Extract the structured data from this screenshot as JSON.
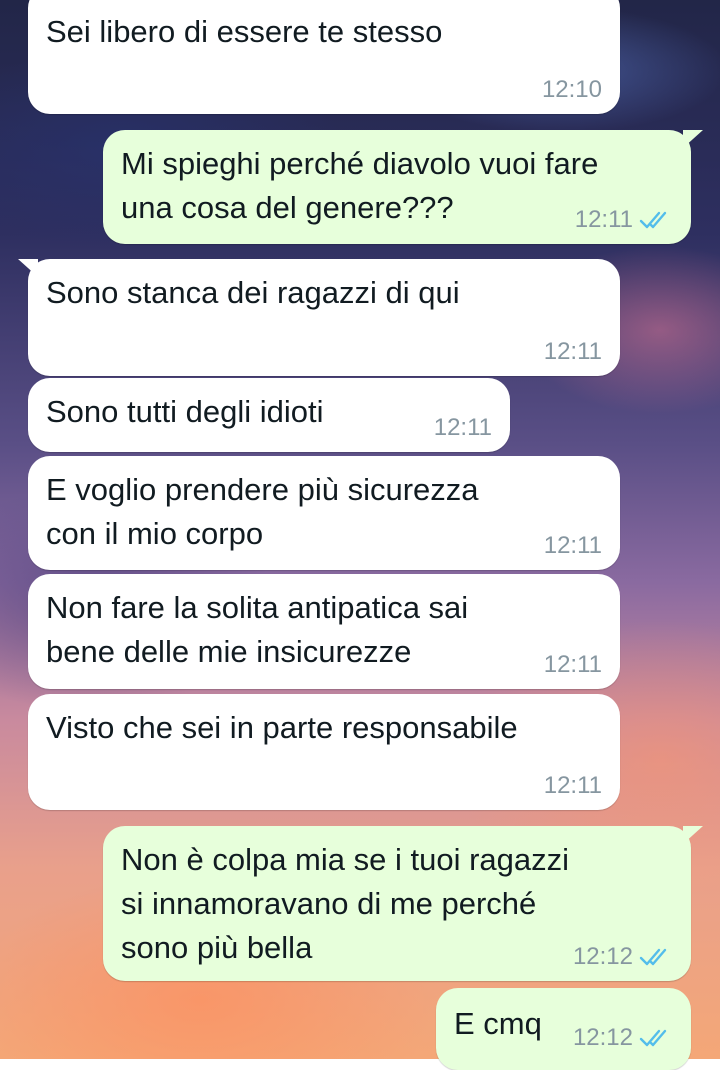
{
  "conversation": {
    "messages": [
      {
        "direction": "incoming",
        "text": "Sei libero di essere te stesso",
        "time": "12:10"
      },
      {
        "direction": "outgoing",
        "text": "Mi spieghi perché diavolo vuoi fare\nuna cosa del genere???",
        "time": "12:11",
        "status": "read-ticks-icon"
      },
      {
        "direction": "incoming",
        "text": "Sono stanca dei ragazzi di qui",
        "time": "12:11"
      },
      {
        "direction": "incoming",
        "text": "Sono tutti degli idioti",
        "time": "12:11"
      },
      {
        "direction": "incoming",
        "text": "E voglio prendere più sicurezza\ncon il mio corpo",
        "time": "12:11"
      },
      {
        "direction": "incoming",
        "text": "Non fare la solita antipatica sai\nbene delle mie insicurezze",
        "time": "12:11"
      },
      {
        "direction": "incoming",
        "text": "Visto che sei in parte responsabile",
        "time": "12:11"
      },
      {
        "direction": "outgoing",
        "text": "Non è colpa mia se i tuoi ragazzi\nsi innamoravano di me perché\nsono più bella",
        "time": "12:12",
        "status": "read-ticks-icon"
      },
      {
        "direction": "outgoing",
        "text": "E cmq",
        "time": "12:12",
        "status": "read-ticks-icon"
      }
    ]
  },
  "colors": {
    "incoming_bubble": "#ffffff",
    "outgoing_bubble": "#e7ffdb",
    "read_ticks": "#53bdeb",
    "timestamp": "#8696a0"
  }
}
